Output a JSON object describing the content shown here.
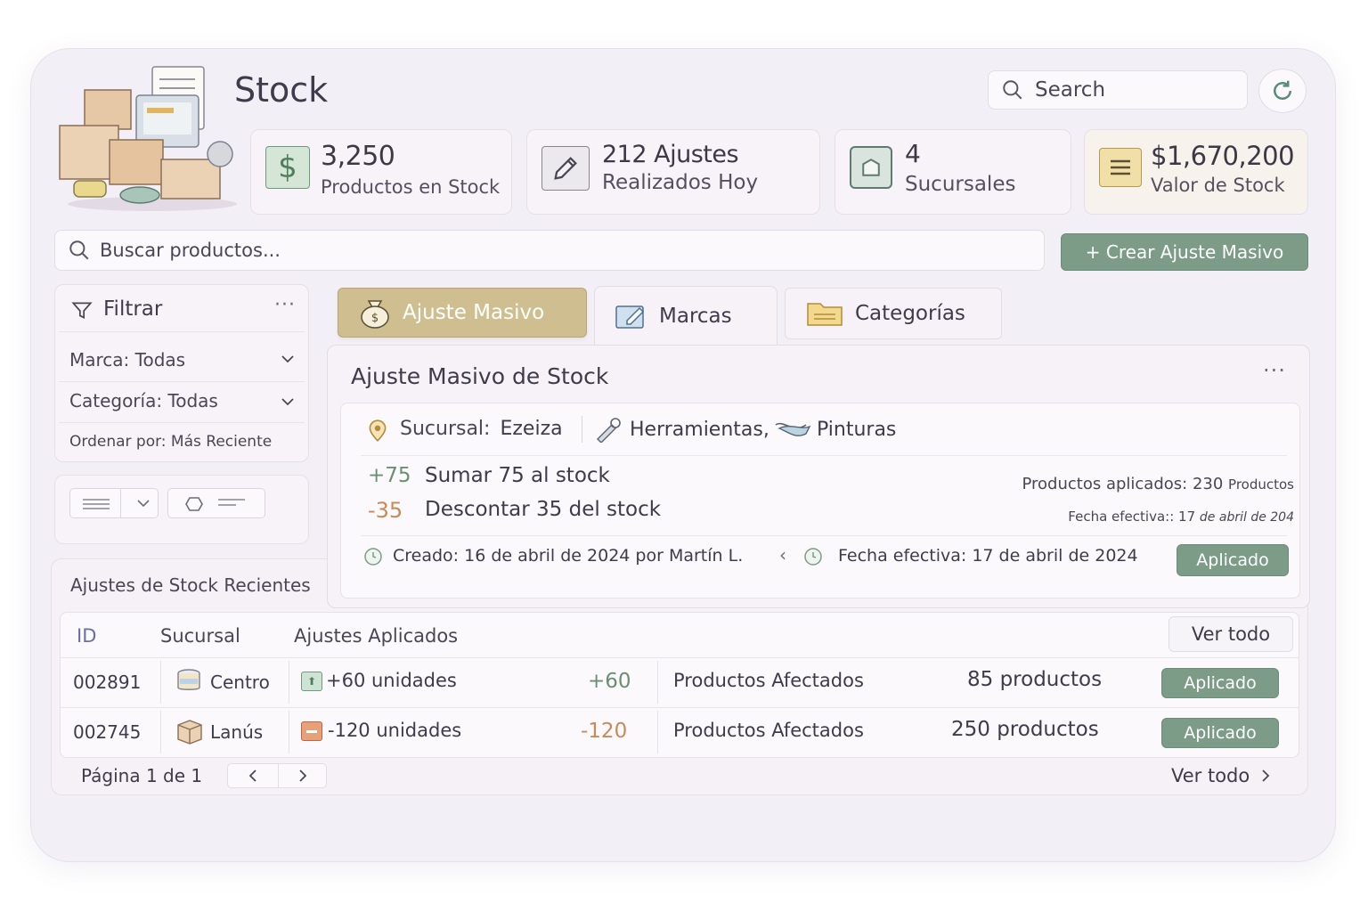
{
  "header": {
    "title": "Stock",
    "search_placeholder": "Search"
  },
  "stats": [
    {
      "value": "3,250",
      "label": "Productos en Stock",
      "icon": "dollar-icon"
    },
    {
      "value": "212 Ajustes",
      "label": "Realizados Hoy",
      "icon": "pencil-icon"
    },
    {
      "value": "4",
      "label": "Sucursales",
      "icon": "store-icon"
    },
    {
      "value": "$1,670,200",
      "label": "Valor de Stock",
      "icon": "list-icon"
    }
  ],
  "product_search": {
    "placeholder": "Buscar productos..."
  },
  "create_button": "+ Crear Ajuste Masivo",
  "filter": {
    "title": "Filtrar",
    "marca": "Marca: Todas",
    "categoria": "Categoría: Todas",
    "ordenar": "Ordenar por: Más Reciente"
  },
  "tabs": [
    "Ajuste Masivo",
    "Marcas",
    "Categorías"
  ],
  "adjust_panel": {
    "title": "Ajuste Masivo de Stock",
    "sucursal_label": "Sucursal:",
    "sucursal_value": "Ezeiza",
    "categories": [
      "Herramientas,",
      "Pinturas"
    ],
    "line1_amount": "+75",
    "line1_text": "Sumar 75 al stock",
    "line2_amount": "-35",
    "line2_text": "Descontar 35 del stock",
    "applied_label": "Productos aplicados:",
    "applied_value": "230",
    "applied_unit": "Productos",
    "effective_label": "Fecha efectiva::",
    "effective_value": "17",
    "effective_rest": "de abril de 204",
    "created": "Creado: 16 de abril de 2024 por Martín L.",
    "effective_full": "Fecha efectiva: 17 de abril de 2024",
    "status": "Aplicado"
  },
  "recent": {
    "title": "Ajustes de Stock Recientes",
    "headers": [
      "ID",
      "Sucursal",
      "Ajustes Aplicados"
    ],
    "view_all": "Ver todo",
    "rows": [
      {
        "id": "002891",
        "branch": "Centro",
        "units": "+60 unidades",
        "delta": "+60",
        "affected_label": "Productos Afectados",
        "affected": "85 productos",
        "status": "Aplicado"
      },
      {
        "id": "002745",
        "branch": "Lanús",
        "units": "-120 unidades",
        "delta": "-120",
        "affected_label": "Productos Afectados",
        "affected": "250 productos",
        "status": "Aplicado"
      }
    ],
    "pagination": "Página 1 de 1",
    "footer_link": "Ver todo"
  },
  "colors": {
    "accent_green": "#7c9c88",
    "tab_active": "#c9b988",
    "amount_orange": "#c98a5a"
  }
}
